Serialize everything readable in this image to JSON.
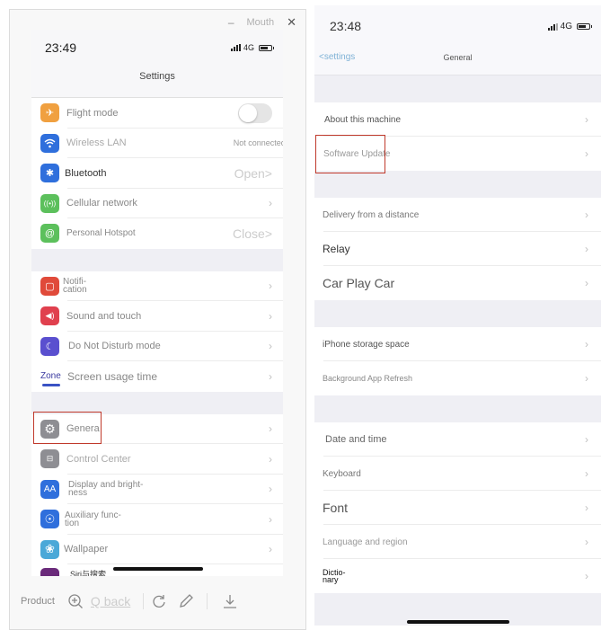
{
  "left_window": {
    "controls": {
      "minimize": "–",
      "title": "Mouth",
      "close": "✕"
    },
    "status_bar": {
      "time": "23:49",
      "network": "4G"
    },
    "nav_title": "Settings",
    "groups": [
      [
        {
          "label": "Flight mode",
          "icon": "airplane-icon",
          "color": "#f0a040",
          "accessory": "toggle",
          "toggle_on": false
        },
        {
          "label": "Wireless LAN",
          "icon": "wifi-icon",
          "color": "#2f6fdc",
          "accessory": "value",
          "value": "Not connected>"
        },
        {
          "label": "Bluetooth",
          "icon": "bluetooth-icon",
          "color": "#2f6fdc",
          "accessory": "value-large",
          "value": "Open>"
        },
        {
          "label": "Cellular network",
          "icon": "antenna-icon",
          "color": "#5cc05c",
          "accessory": "chevron"
        },
        {
          "label": "Personal Hotspot",
          "icon": "hotspot-icon",
          "color": "#5cc05c",
          "accessory": "value-large",
          "value": "Close>"
        }
      ],
      [
        {
          "label_line1": "Notifi-",
          "label_line2": "cation",
          "icon": "notification-icon",
          "color": "#e04a3a",
          "accessory": "chevron"
        },
        {
          "label": "Sound and touch",
          "icon": "speaker-icon",
          "color": "#e0404e",
          "accessory": "chevron"
        },
        {
          "label": "Do Not Disturb mode",
          "icon": "moon-icon",
          "color": "#5a4fcf",
          "accessory": "chevron"
        },
        {
          "icon_text": "Zone",
          "label": "Screen usage time",
          "icon": "hourglass-icon",
          "accessory": "chevron"
        }
      ],
      [
        {
          "label": "Genera",
          "icon": "gear-icon",
          "color": "#8e8e93",
          "accessory": "chevron",
          "highlighted": true
        },
        {
          "label": "Control Center",
          "icon": "switches-icon",
          "color": "#8e8e93",
          "accessory": "chevron"
        },
        {
          "label_line1": "Display and bright-",
          "label_line2": "ness",
          "icon": "text-size-icon",
          "color": "#2f6fdc",
          "icon_text": "AA",
          "accessory": "chevron"
        },
        {
          "label_line1": "Auxiliary func-",
          "label_line2": "tion",
          "icon": "accessibility-icon",
          "color": "#2f6fdc",
          "accessory": "chevron"
        },
        {
          "label": "Wallpaper",
          "icon": "flower-icon",
          "color": "#4aa8d8",
          "accessory": "chevron"
        },
        {
          "label": "Siri与搜索",
          "icon": "siri-icon",
          "color": "#6a2a7a",
          "accessory": "chevron"
        }
      ]
    ],
    "toolbar": {
      "product_label": "Product",
      "back_label": "Q back"
    }
  },
  "right_window": {
    "status_bar": {
      "time": "23:48",
      "network": "4G"
    },
    "nav": {
      "back_label": "<settings",
      "title": "General"
    },
    "groups": [
      [
        {
          "label": "About this machine"
        },
        {
          "label": "Software Update",
          "highlighted": true
        }
      ],
      [
        {
          "label": "Delivery from a distance"
        },
        {
          "label": "Relay",
          "size": "medium"
        },
        {
          "label": "Car Play Car",
          "size": "large"
        }
      ],
      [
        {
          "label": "iPhone storage space"
        },
        {
          "label": "Background App Refresh",
          "size": "small"
        }
      ],
      [
        {
          "label": "Date and time",
          "size": "medium-small"
        },
        {
          "label": "Keyboard"
        },
        {
          "label": "Font",
          "size": "large"
        },
        {
          "label": "Language and region",
          "size": "small"
        },
        {
          "label_line1": "Dictio-",
          "label_line2": "nary"
        }
      ]
    ]
  },
  "chevron": "›",
  "colors": {
    "highlight": "#c0392b",
    "back_link": "#7fb2d6"
  }
}
